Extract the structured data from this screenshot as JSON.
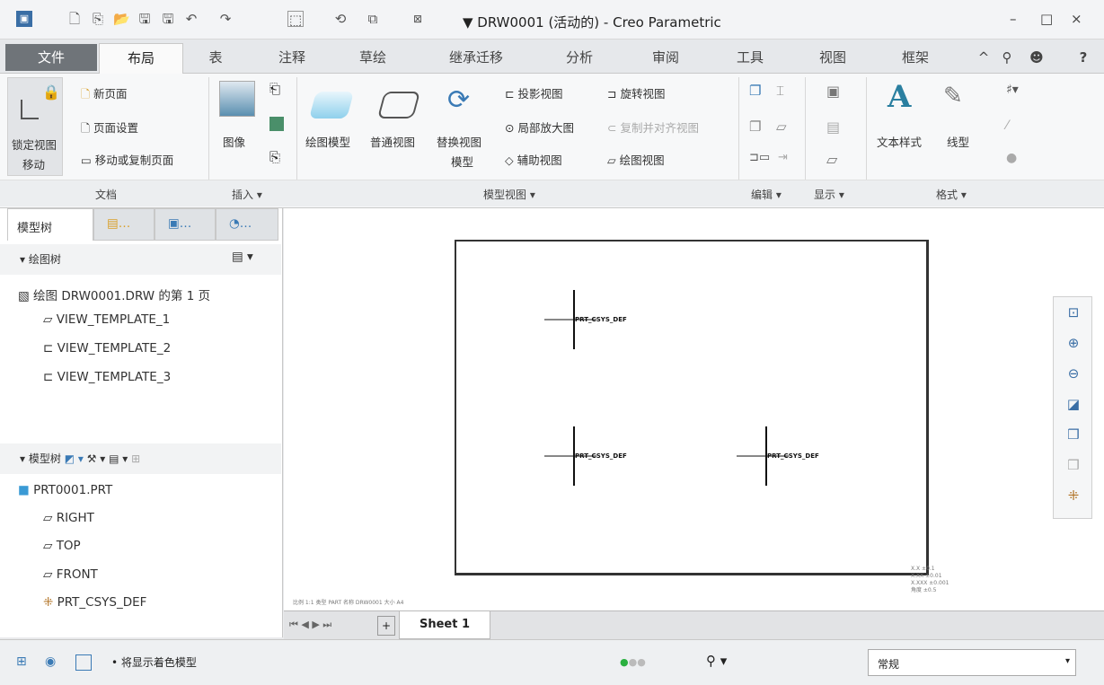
{
  "titlebar": {
    "title": "▼ DRW0001 (活动的) - Creo Parametric",
    "minimize": "–",
    "maximize": "□",
    "close": "×"
  },
  "tabs": [
    {
      "label": "文件"
    },
    {
      "label": "布局"
    },
    {
      "label": "表"
    },
    {
      "label": "注释"
    },
    {
      "label": "草绘"
    },
    {
      "label": "继承迁移"
    },
    {
      "label": "分析"
    },
    {
      "label": "审阅"
    },
    {
      "label": "工具"
    },
    {
      "label": "视图"
    },
    {
      "label": "框架"
    }
  ],
  "ribbon": {
    "doc": {
      "lock": "锁定视图",
      "lock2": "移动",
      "new_page": "新页面",
      "page_setup": "页面设置",
      "move_copy": "移动或复制页面",
      "group": "文档"
    },
    "insert": {
      "image": "图像",
      "group": "插入 ▾"
    },
    "model_views": {
      "drawing_model": "绘图模型",
      "general_view": "普通视图",
      "replace1": "替换视图",
      "replace2": "模型",
      "projection": "投影视图",
      "detailed": "局部放大图",
      "auxiliary": "辅助视图",
      "revolved": "旋转视图",
      "copy_align": "复制并对齐视图",
      "drawing_view": "绘图视图",
      "group": "模型视图 ▾"
    },
    "edit": {
      "group": "编辑 ▾"
    },
    "display": {
      "group": "显示 ▾"
    },
    "format": {
      "text_style": "文本样式",
      "line_style": "线型",
      "group": "格式 ▾"
    }
  },
  "left": {
    "tab1": "模型树",
    "drawing_tree": "绘图树",
    "drawing_items": [
      "绘图 DRW0001.DRW 的第 1 页",
      "VIEW_TEMPLATE_1",
      "VIEW_TEMPLATE_2",
      "VIEW_TEMPLATE_3"
    ],
    "model_tree": "模型树",
    "model_items": [
      "PRT0001.PRT",
      "RIGHT",
      "TOP",
      "FRONT",
      "PRT_CSYS_DEF"
    ]
  },
  "canvas": {
    "csys_label": "PRT_CSYS_DEF",
    "notes_left": "比例 1:1   类型 PART   名称 DRW0001   大小 A4",
    "notes_right": [
      "X.X  ±0.1",
      "X.XX  ±0.01",
      "X.XXX  ±0.001",
      "角度  ±0.5"
    ]
  },
  "sheetbar": {
    "add": "+",
    "sheet": "Sheet 1"
  },
  "status": {
    "message": "• 将显示着色模型",
    "filter": "常规"
  }
}
